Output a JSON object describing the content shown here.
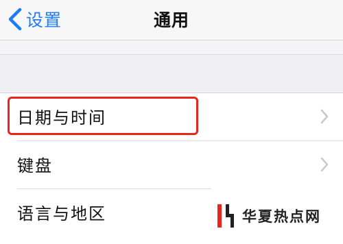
{
  "nav": {
    "back_label": "设置",
    "title": "通用"
  },
  "settings": {
    "items": [
      {
        "label": "日期与时间",
        "chevron": "chevron-right-icon",
        "highlighted": true
      },
      {
        "label": "键盘",
        "chevron": "chevron-right-icon",
        "highlighted": false
      },
      {
        "label": "语言与地区",
        "chevron": "none",
        "highlighted": false
      }
    ]
  },
  "watermark": {
    "text": "华夏热点网",
    "logo": "hx-logo"
  },
  "colors": {
    "accent": "#1e7cf7",
    "highlight": "#e8241f",
    "background": "#efeff4",
    "chevron": "#c7c7cc",
    "watermark_red": "#e8241f"
  }
}
